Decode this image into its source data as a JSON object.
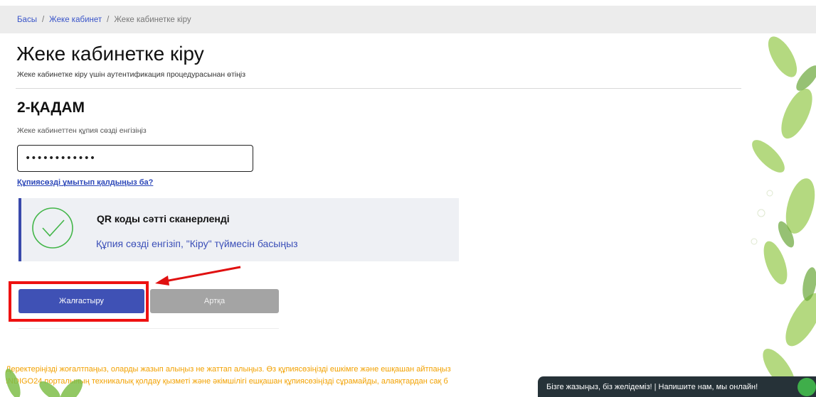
{
  "breadcrumb": {
    "home": "Басы",
    "cabinet": "Жеке кабинет",
    "current": "Жеке кабинетке кіру"
  },
  "page": {
    "title": "Жеке кабинетке кіру",
    "subtitle": "Жеке кабинетке кіру үшін аутентификация процедурасынан өтіңіз"
  },
  "step": {
    "title": "2-ҚАДАМ",
    "hint": "Жеке кабинеттен құпия сөзді енгізіңіз",
    "password_value": "••••••••••••",
    "forgot_link": "Құпиясөзді ұмытып қалдыңыз ба?"
  },
  "qr_panel": {
    "title": "QR коды сәтті сканерленді",
    "description": "Құпия сөзді енгізіп, \"Кіру\" түймесін басыңыз"
  },
  "buttons": {
    "continue": "Жалғастыру",
    "back": "Артқа"
  },
  "warning": {
    "line1": "Деректеріңізді жоғалтпаңыз, оларды жазып алыңыз не жаттап алыңыз. Өз құпиясөзіңізді ешкімге және ешқашан айтпаңыз",
    "line2": "INDIGO24 порталының техникалық қолдау қызметі және әкімшілігі ешқашан құпиясөзіңізді сұрамайды, алаяқтардан сақ б"
  },
  "chat": {
    "label": "Бізге жазыңыз, біз желідеміз! | Напишите нам, мы онлайн!"
  },
  "colors": {
    "accent": "#3f51b5",
    "warning": "#f2a100",
    "highlight": "#ee1111",
    "success": "#43b649"
  }
}
